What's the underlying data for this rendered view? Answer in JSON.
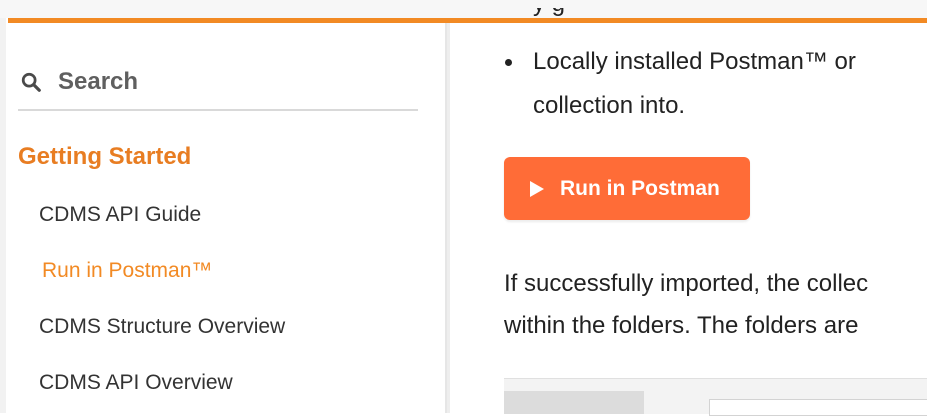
{
  "sidebar": {
    "search": {
      "placeholder": "Search"
    },
    "section_title": "Getting Started",
    "items": [
      {
        "label": "CDMS API Guide",
        "active": false
      },
      {
        "label": "Run in Postman™",
        "active": true
      },
      {
        "label": "CDMS Structure Overview",
        "active": false
      },
      {
        "label": "CDMS API Overview",
        "active": false
      }
    ]
  },
  "content": {
    "bullet_top_fragment": "y                    g",
    "bullet_line_1": "Locally installed Postman™ or",
    "bullet_line_2": "collection into.",
    "run_button_label": "Run in Postman",
    "para_line_1": "If successfully imported, the collec",
    "para_line_2": "within the folders. The folders are"
  },
  "colors": {
    "accent": "#f28a24",
    "section_title": "#e87d22",
    "run_button": "#ff6c37"
  },
  "icons": {
    "search": "magnifier",
    "play": "play-triangle"
  }
}
